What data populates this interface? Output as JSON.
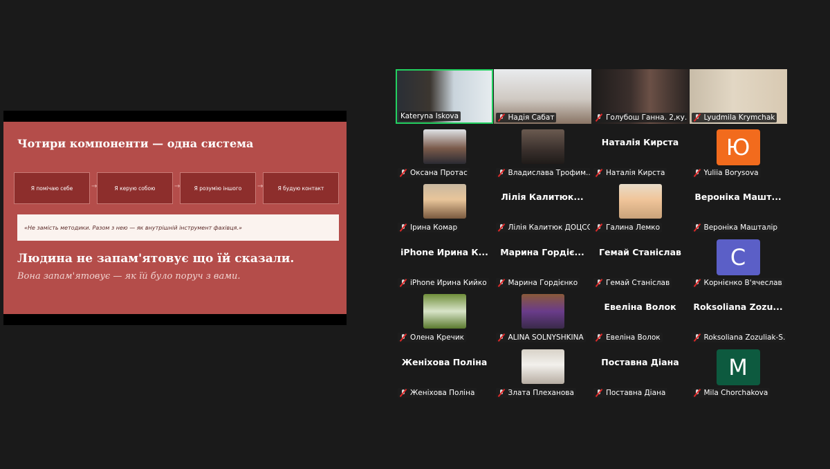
{
  "slide": {
    "title": "Чотири компоненти — одна система",
    "steps": [
      "Я помічаю себе",
      "Я керую собою",
      "Я розумію іншого",
      "Я будую контакт"
    ],
    "quote": "«Не замість методики. Разом з нею — як внутрішній інструмент фахівця.»",
    "headline": "Людина не запам'ятовує що їй сказали.",
    "subheadline": "Вона запам'ятовує — як їй було поруч з вами."
  },
  "participants": [
    {
      "label": "Kateryna Iskova",
      "kind": "video",
      "active": true,
      "muted": false
    },
    {
      "label": "Надія Сабат",
      "kind": "video",
      "muted": true
    },
    {
      "label": "Голубош Ганна. 2,ку...",
      "kind": "video",
      "muted": true
    },
    {
      "label": "Lyudmila Krymchak",
      "kind": "video",
      "muted": true
    },
    {
      "label": "Оксана Протас",
      "kind": "photo",
      "muted": true
    },
    {
      "label": "Владислава Трофим...",
      "kind": "photo",
      "muted": true
    },
    {
      "label": "Наталія Кирста",
      "kind": "name",
      "display": "Наталія Кирста",
      "muted": true
    },
    {
      "label": "Yuliia Borysova",
      "kind": "letter",
      "letter": "Ю",
      "letter_color": "#f26b1d",
      "muted": true
    },
    {
      "label": "Ірина Комар",
      "kind": "photo",
      "muted": true
    },
    {
      "label": "Лілія Калитюк ДОЦСС",
      "kind": "name",
      "display": "Лілія  Калитюк...",
      "muted": true
    },
    {
      "label": "Галина Лемко",
      "kind": "photo",
      "muted": true
    },
    {
      "label": "Вероніка Машталір",
      "kind": "name",
      "display": "Вероніка  Машт...",
      "muted": true
    },
    {
      "label": "iPhone Ирина Кийко",
      "kind": "name",
      "display": "iPhone  Ирина  К...",
      "muted": true
    },
    {
      "label": "Марина Гордієнко",
      "kind": "name",
      "display": "Марина  Гордіє...",
      "muted": true
    },
    {
      "label": "Гемай Станіслав",
      "kind": "name",
      "display": "Гемай Станіслав",
      "muted": true
    },
    {
      "label": "Корнієнко В'ячеслав",
      "kind": "letter",
      "letter": "C",
      "letter_color": "#5b5fc7",
      "muted": true
    },
    {
      "label": "Олена Кречик",
      "kind": "photo",
      "muted": true
    },
    {
      "label": "ALINA SOLNYSHKINA",
      "kind": "photo",
      "muted": true
    },
    {
      "label": "Евеліна Волок",
      "kind": "name",
      "display": "Евеліна Волок",
      "muted": true
    },
    {
      "label": "Roksoliana Zozuliak-S...",
      "kind": "name",
      "display": "Roksoliana  Zozu...",
      "muted": true
    },
    {
      "label": "Женіхова Поліна",
      "kind": "name",
      "display": "Женіхова Поліна",
      "muted": true
    },
    {
      "label": "Злата Плеханова",
      "kind": "photo",
      "muted": true
    },
    {
      "label": "Поставна Діана",
      "kind": "name",
      "display": "Поставна Діана",
      "muted": true
    },
    {
      "label": "Mila Chorchakova",
      "kind": "letter",
      "letter": "M",
      "letter_color": "#0d5a3f",
      "muted": true
    }
  ]
}
